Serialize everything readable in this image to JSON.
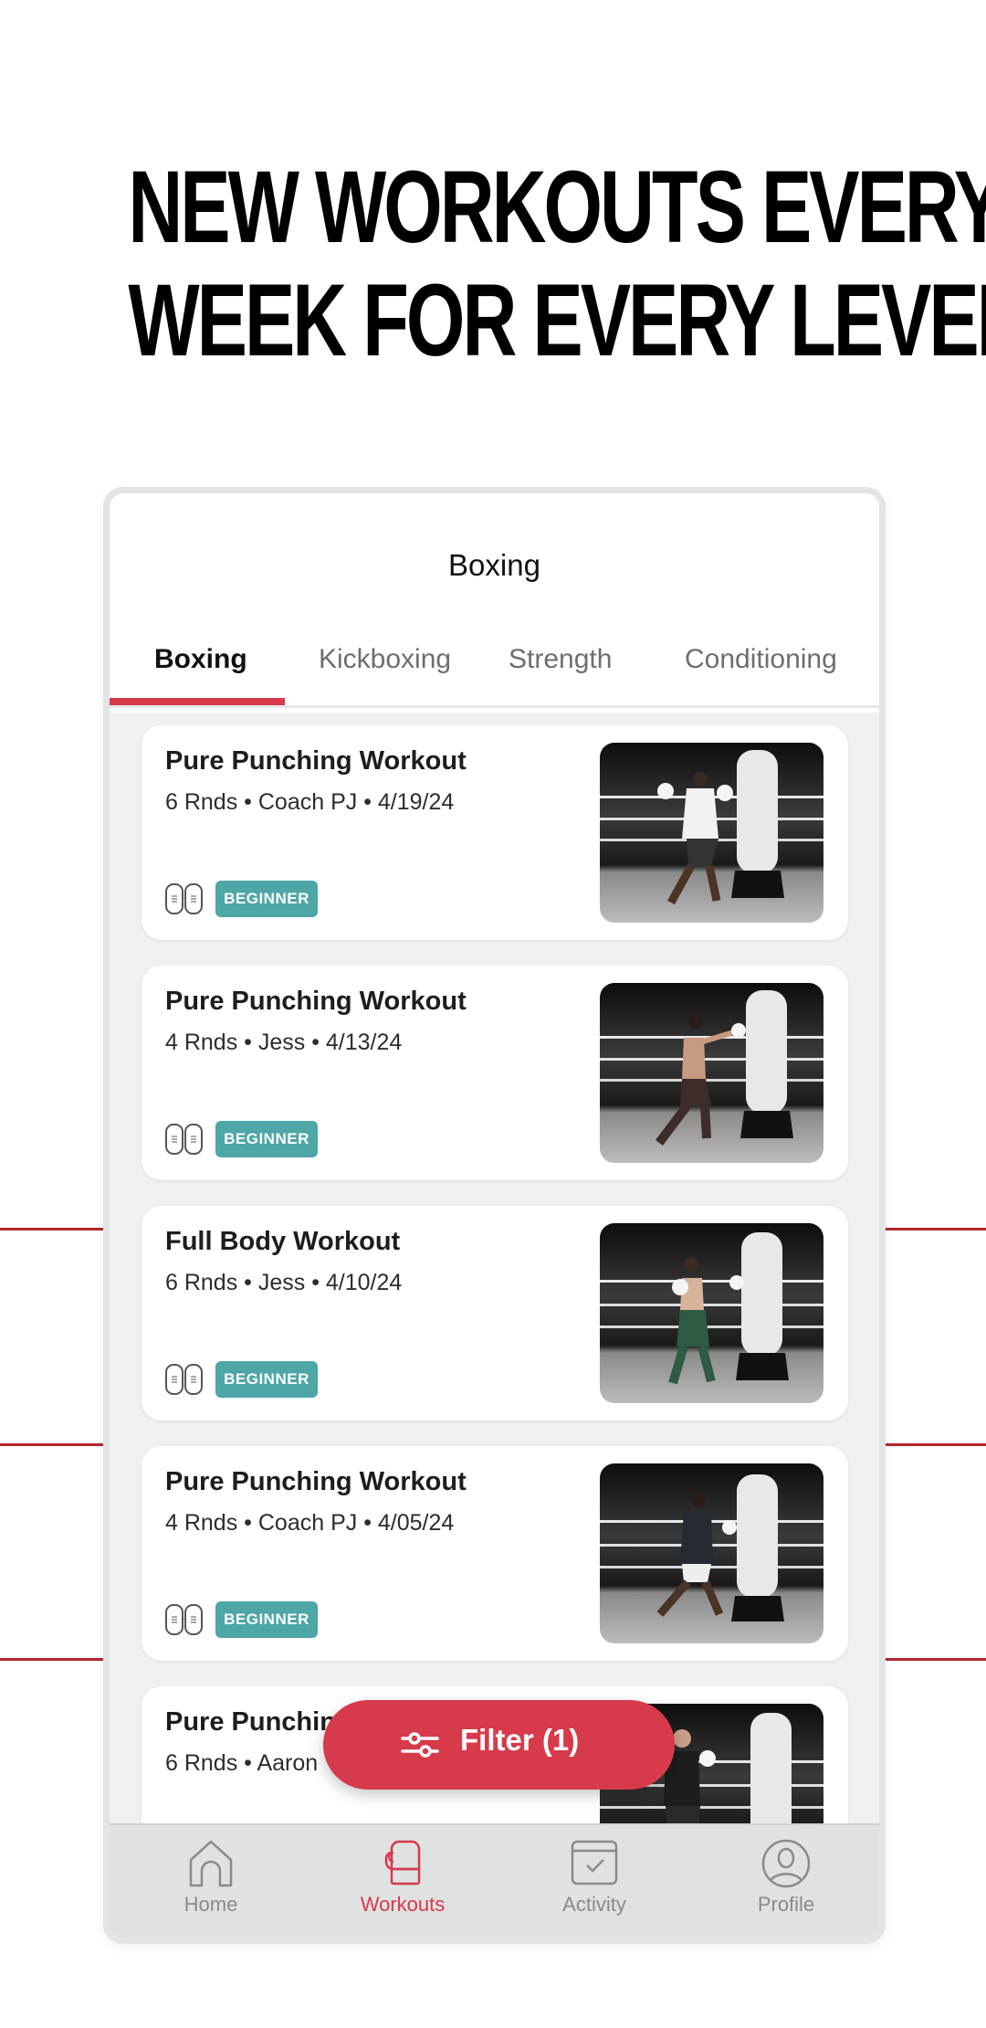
{
  "headline": {
    "line1": "NEW WORKOUTS EVERY",
    "line2": "WEEK FOR EVERY LEVEL"
  },
  "colors": {
    "accent": "#d63a4b",
    "badge": "#4ea6a6",
    "decor_line": "#b3262f"
  },
  "app": {
    "screen_title": "Boxing",
    "tabs": [
      {
        "label": "Boxing",
        "active": true
      },
      {
        "label": "Kickboxing",
        "active": false
      },
      {
        "label": "Strength",
        "active": false
      },
      {
        "label": "Conditioning",
        "active": false
      }
    ],
    "workouts": [
      {
        "title": "Pure Punching Workout",
        "meta": "6 Rnds • Coach PJ • 4/19/24",
        "level": "BEGINNER",
        "icon": "trackers-icon",
        "thumbnail": "man in white shirt shadowboxing beside heavy bag"
      },
      {
        "title": "Pure Punching Workout",
        "meta": "4 Rnds • Jess • 4/13/24",
        "level": "BEGINNER",
        "icon": "trackers-icon",
        "thumbnail": "woman punching heavy bag"
      },
      {
        "title": "Full Body Workout",
        "meta": "6 Rnds • Jess • 4/10/24",
        "level": "BEGINNER",
        "icon": "trackers-icon",
        "thumbnail": "woman in green leggings punching heavy bag"
      },
      {
        "title": "Pure Punching Workout",
        "meta": "4 Rnds • Coach PJ • 4/05/24",
        "level": "BEGINNER",
        "icon": "trackers-icon",
        "thumbnail": "man in dark shirt punching heavy bag"
      },
      {
        "title": "Pure Punching Workout",
        "meta": "6 Rnds • Aaron",
        "level": "",
        "icon": "",
        "thumbnail": "bald man guarding beside heavy bag"
      }
    ],
    "filter_button": {
      "label": "Filter (1)",
      "icon": "sliders-icon"
    },
    "bottom_nav": [
      {
        "label": "Home",
        "icon": "home-icon",
        "active": false
      },
      {
        "label": "Workouts",
        "icon": "boxing-glove-icon",
        "active": true
      },
      {
        "label": "Activity",
        "icon": "calendar-check-icon",
        "active": false
      },
      {
        "label": "Profile",
        "icon": "profile-icon",
        "active": false
      }
    ]
  }
}
